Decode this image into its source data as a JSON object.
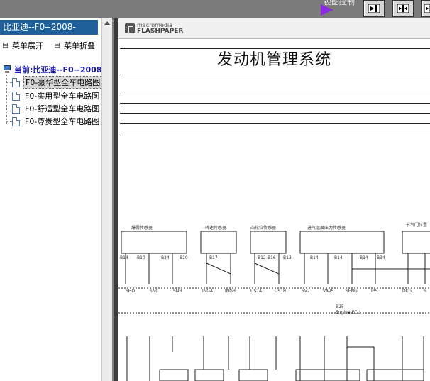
{
  "toolbar": {
    "view_control_label": "视图控制"
  },
  "tree_pane": {
    "title": "比亚迪--F0--2008-",
    "expand_label": "菜单展开",
    "collapse_label": "菜单折叠",
    "root_label": "当前:比亚迪--F0--2008-",
    "items": [
      {
        "label": "F0-豪华型全车电路图",
        "selected": true
      },
      {
        "label": "F0-实用型全车电路图",
        "selected": false
      },
      {
        "label": "F0-舒适型全车电路图",
        "selected": false
      },
      {
        "label": "F0-尊贵型全车电路图",
        "selected": false
      }
    ]
  },
  "viewer": {
    "logo_top": "macromedia",
    "logo_bottom": "FLASHPAPER",
    "page_title": "发动机管理系统",
    "components": [
      "爆震传感器",
      "转速传感器",
      "凸轮位传感器",
      "进气温度压力传感器",
      "节气门位置"
    ],
    "ecu_label_1": "B25",
    "ecu_label_2": "Engine ECU",
    "pins_top": [
      "B14",
      "B10",
      "B24",
      "B10",
      "B17",
      "B12",
      "B16",
      "B13",
      "B14",
      "B14",
      "B14",
      "B34"
    ],
    "pins_bottom": [
      "SHD",
      "SNC",
      "SNB",
      "INGA",
      "INGB",
      "US1A",
      "US1B",
      "5V2",
      "VAVS",
      "SENG",
      "IPS",
      "DKG",
      "S"
    ]
  }
}
